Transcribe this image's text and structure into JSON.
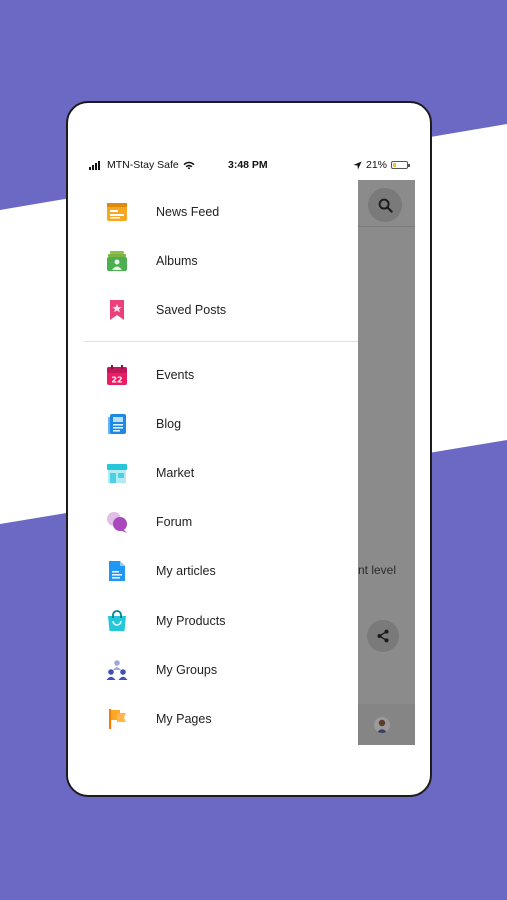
{
  "status_bar": {
    "carrier": "MTN-Stay Safe",
    "time": "3:48 PM",
    "battery_percent": "21%",
    "battery_level": 0.21
  },
  "background_app": {
    "text_fragment": "nt level"
  },
  "drawer": {
    "primary_items": [
      {
        "label": "News Feed",
        "icon": "news-feed-icon"
      },
      {
        "label": "Albums",
        "icon": "albums-icon"
      },
      {
        "label": "Saved Posts",
        "icon": "saved-posts-icon"
      }
    ],
    "secondary_items": [
      {
        "label": "Events",
        "icon": "events-icon"
      },
      {
        "label": "Blog",
        "icon": "blog-icon"
      },
      {
        "label": "Market",
        "icon": "market-icon"
      },
      {
        "label": "Forum",
        "icon": "forum-icon"
      },
      {
        "label": "My articles",
        "icon": "articles-icon"
      },
      {
        "label": "My Products",
        "icon": "products-icon"
      },
      {
        "label": "My Groups",
        "icon": "groups-icon"
      },
      {
        "label": "My Pages",
        "icon": "pages-icon"
      }
    ]
  },
  "colors": {
    "background": "#6C69C4",
    "stripe": "#ffffff",
    "overlay": "#8b8b8b"
  }
}
